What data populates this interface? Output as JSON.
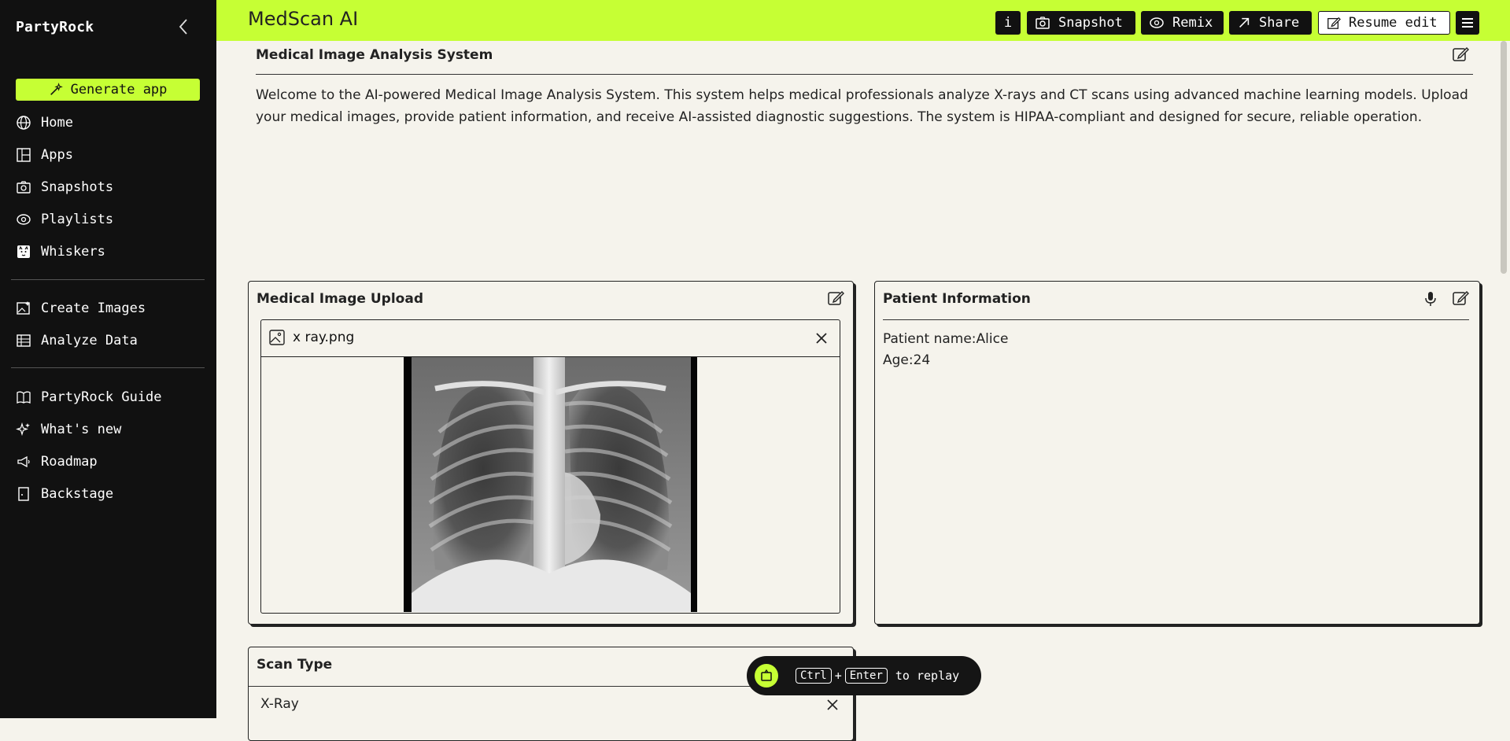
{
  "sidebar": {
    "brand": "PartyRock",
    "generate_label": "Generate app",
    "nav_main": [
      {
        "label": "Home",
        "icon": "globe-icon"
      },
      {
        "label": "Apps",
        "icon": "apps-grid-icon"
      },
      {
        "label": "Snapshots",
        "icon": "camera-icon"
      },
      {
        "label": "Playlists",
        "icon": "playlist-icon"
      },
      {
        "label": "Whiskers",
        "icon": "cat-icon"
      }
    ],
    "nav_tools": [
      {
        "label": "Create Images",
        "icon": "image-sparkle-icon"
      },
      {
        "label": "Analyze Data",
        "icon": "data-icon"
      }
    ],
    "nav_help": [
      {
        "label": "PartyRock Guide",
        "icon": "book-icon"
      },
      {
        "label": "What's new",
        "icon": "sparkle-icon"
      },
      {
        "label": "Roadmap",
        "icon": "megaphone-icon"
      },
      {
        "label": "Backstage",
        "icon": "door-icon"
      }
    ]
  },
  "topbar": {
    "app_title": "MedScan AI",
    "info_label": "i",
    "snapshot_label": "Snapshot",
    "remix_label": "Remix",
    "share_label": "Share",
    "resume_label": "Resume edit"
  },
  "intro": {
    "title": "Medical Image Analysis System",
    "text": "Welcome to the AI-powered Medical Image Analysis System. This system helps medical professionals analyze X-rays and CT scans using advanced machine learning models. Upload your medical images, provide patient information, and receive AI-assisted diagnostic suggestions. The system is HIPAA-compliant and designed for secure, reliable operation."
  },
  "upload": {
    "title": "Medical Image Upload",
    "file_name": "x ray.png"
  },
  "patient": {
    "title": "Patient Information",
    "line1": "Patient name:Alice",
    "line2": "Age:24"
  },
  "scan": {
    "title": "Scan Type",
    "value": "X-Ray"
  },
  "toast": {
    "key1": "Ctrl",
    "plus": "+",
    "key2": "Enter",
    "text": "to replay"
  },
  "colors": {
    "accent": "#c6ff34",
    "sidebar_bg": "#111111",
    "page_bg": "#f5f3ec"
  }
}
